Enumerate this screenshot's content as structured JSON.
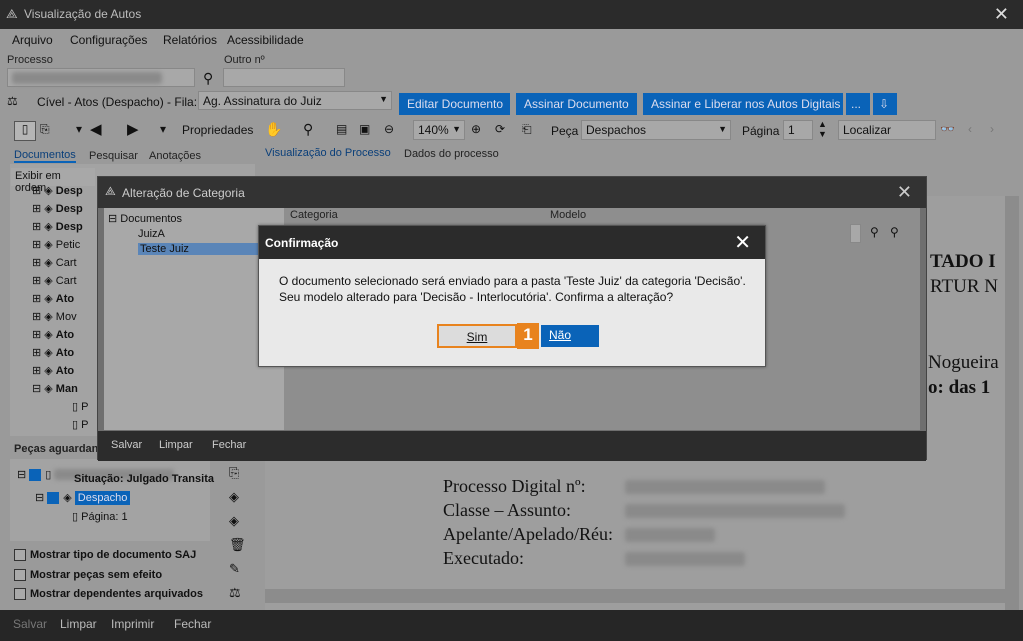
{
  "window": {
    "title": "Visualização de Autos"
  },
  "menu": [
    "Arquivo",
    "Configurações",
    "Relatórios",
    "Acessibilidade"
  ],
  "process": {
    "label": "Processo",
    "other_label": "Outro nº"
  },
  "queue": {
    "label": "Cível - Atos (Despacho) - Fila:",
    "value": "Ag. Assinatura do Juiz",
    "buttons": [
      "Editar Documento",
      "Assinar Documento",
      "Assinar e Liberar nos Autos Digitais",
      "..."
    ]
  },
  "toolbar": {
    "properties": "Propriedades",
    "zoom": "140%",
    "piece_label": "Peça",
    "piece_value": "Despachos",
    "page_label": "Página",
    "page_value": "1",
    "search_value": "Localizar"
  },
  "left_tabs": [
    "Documentos",
    "Pesquisar",
    "Anotações"
  ],
  "sort_value": "Exibir em ordem",
  "tree_items": [
    "Desp",
    "Desp",
    "Desp",
    "Petic",
    "Cart",
    "Cart",
    "Ato",
    "Mov",
    "Ato",
    "Ato",
    "Ato",
    "Man",
    "P",
    "P"
  ],
  "pending": {
    "header": "Peças aguardan",
    "situation": "Situação: Julgado Transita",
    "despacho": "Despacho",
    "page": "Página: 1"
  },
  "options": [
    "Mostrar tipo de documento SAJ",
    "Mostrar peças sem efeito",
    "Mostrar dependentes arquivados"
  ],
  "doc_tabs": [
    "Visualização do Processo",
    "Dados do processo"
  ],
  "document": {
    "line1": "TADO I",
    "line2": "RTUR N",
    "line3": "Nogueira",
    "line4": "o: das 1",
    "fields": [
      "Processo Digital nº:",
      "Classe – Assunto:",
      "Apelante/Apelado/Réu:",
      "Executado:"
    ]
  },
  "footer": [
    "Salvar",
    "Limpar",
    "Imprimir",
    "Fechar"
  ],
  "category_dialog": {
    "title": "Alteração de Categoria",
    "tree_root": "Documentos",
    "tree_children": [
      "JuizA",
      "Teste Juiz"
    ],
    "category_label": "Categoria",
    "model_label": "Modelo",
    "footer": [
      "Salvar",
      "Limpar",
      "Fechar"
    ]
  },
  "confirm_dialog": {
    "title": "Confirmação",
    "message": "O documento selecionado será enviado para a pasta 'Teste Juiz' da categoria 'Decisão'. Seu modelo alterado para 'Decisão - Interlocutória'. Confirma a alteração?",
    "yes": "Sim",
    "no": "Não",
    "step_badge": "1"
  },
  "colors": {
    "accent": "#0a63b8",
    "highlight": "#e8831e",
    "titlebar": "#2b2b2b"
  }
}
